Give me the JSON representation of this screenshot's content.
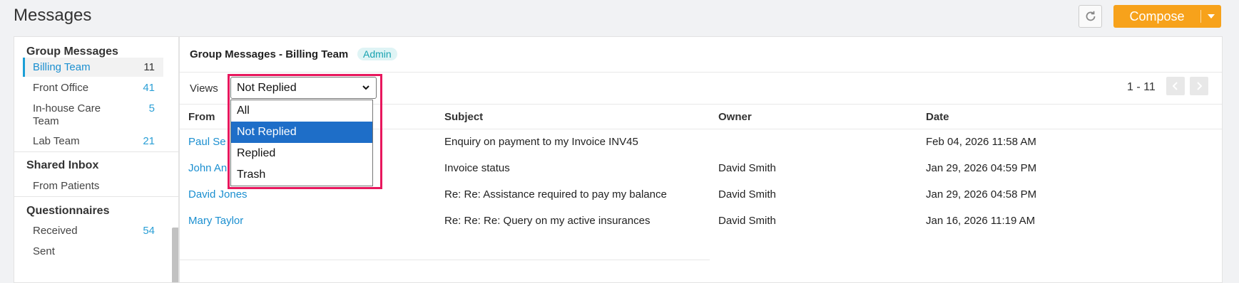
{
  "page": {
    "title": "Messages"
  },
  "toolbar": {
    "compose_label": "Compose",
    "refresh_icon": "refresh-icon",
    "accent": "#f7a21b"
  },
  "sidebar": {
    "group_header": "Group Messages",
    "groups": [
      {
        "label": "Billing Team",
        "count": "11"
      },
      {
        "label": "Front Office",
        "count": "41"
      },
      {
        "label": "In-house Care",
        "label2": "Team",
        "count": "5"
      },
      {
        "label": "Lab Team",
        "count": "21"
      }
    ],
    "shared_header": "Shared Inbox",
    "shared": [
      {
        "label": "From Patients"
      }
    ],
    "quest_header": "Questionnaires",
    "quest": [
      {
        "label": "Received",
        "count": "54"
      },
      {
        "label": "Sent"
      }
    ]
  },
  "main": {
    "title": "Group Messages - Billing Team",
    "badge": "Admin",
    "views_label": "Views",
    "views_selected": "Not Replied",
    "views_options": [
      "All",
      "Not Replied",
      "Replied",
      "Trash"
    ],
    "pagination": "1 - 11",
    "columns": {
      "from": "From",
      "subject": "Subject",
      "owner": "Owner",
      "date": "Date"
    },
    "rows": [
      {
        "from": "Paul Se",
        "subject": "Enquiry on payment to my Invoice INV45",
        "owner": "",
        "date": "Feb 04, 2026 11:58 AM"
      },
      {
        "from": "John An",
        "subject": "Invoice status",
        "owner": "David Smith",
        "date": "Jan 29, 2026 04:59 PM"
      },
      {
        "from": "David Jones",
        "subject": "Re: Re: Assistance required to pay my balance",
        "owner": "David Smith",
        "date": "Jan 29, 2026 04:58 PM"
      },
      {
        "from": "Mary Taylor",
        "subject": "Re: Re: Re: Query on my active insurances",
        "owner": "David Smith",
        "date": "Jan 16, 2026 11:19 AM"
      }
    ]
  }
}
